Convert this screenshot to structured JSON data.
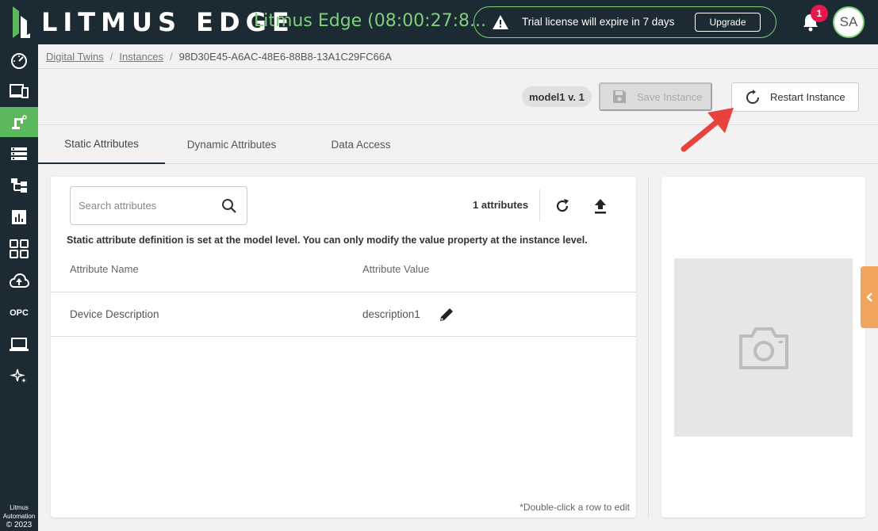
{
  "header": {
    "logo_text": "LITMUS EDGE",
    "env_name": "Litmus Edge (08:00:27:8...",
    "trial_text": "Trial license will expire in 7 days",
    "upgrade_label": "Upgrade",
    "notification_count": "1",
    "avatar_initials": "SA"
  },
  "sidebar": {
    "items": [
      {
        "icon": "dashboard-icon"
      },
      {
        "icon": "devices-icon"
      },
      {
        "icon": "digital-twins-icon",
        "active": true
      },
      {
        "icon": "list-icon"
      },
      {
        "icon": "flows-icon"
      },
      {
        "icon": "analytics-icon"
      },
      {
        "icon": "applications-icon"
      },
      {
        "icon": "cloud-upload-icon"
      },
      {
        "label": "OPC"
      },
      {
        "icon": "laptop-icon"
      },
      {
        "icon": "sparkle-icon"
      }
    ],
    "copyright_line1": "Litmus",
    "copyright_line2": "Automation",
    "copyright_year": "© 2023"
  },
  "breadcrumb": {
    "items": [
      "Digital Twins",
      "Instances"
    ],
    "separator": "/",
    "current": "98D30E45-A6AC-48E6-88B8-13A1C29FC66A"
  },
  "toolbar": {
    "model_chip": "model1 v. 1",
    "save_label": "Save Instance",
    "restart_label": "Restart Instance"
  },
  "tabs": [
    {
      "label": "Static Attributes",
      "active": true
    },
    {
      "label": "Dynamic Attributes"
    },
    {
      "label": "Data Access"
    }
  ],
  "attributes": {
    "search_placeholder": "Search attributes",
    "count_text": "1 attributes",
    "note": "Static attribute definition is set at the model level. You can only modify the value property at the instance level.",
    "columns": [
      "Attribute Name",
      "Attribute Value"
    ],
    "rows": [
      {
        "name": "Device Description",
        "value": "description1"
      }
    ],
    "hint": "*Double-click a row to edit"
  },
  "colors": {
    "nav_bg": "#1c2a33",
    "accent_green": "#5cb85c",
    "env_green": "#7fd07a",
    "badge_red": "#e8174f",
    "collapse_orange": "#f0a45c",
    "arrow_red": "#e8423f"
  }
}
